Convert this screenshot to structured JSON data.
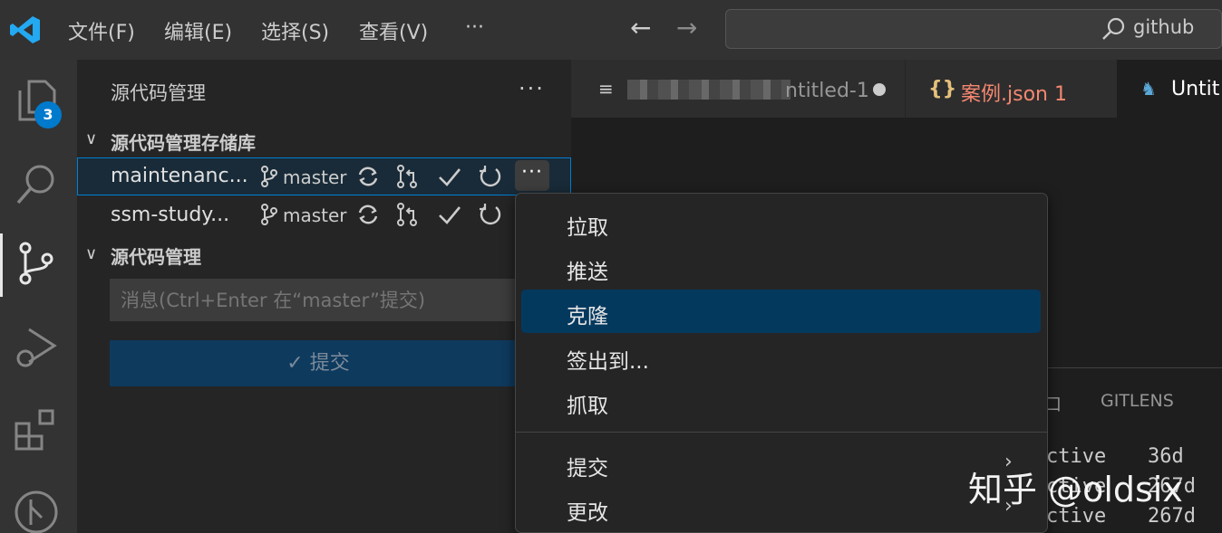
{
  "titlebar": {
    "menus": [
      "文件(F)",
      "编辑(E)",
      "选择(S)",
      "查看(V)",
      "···"
    ],
    "search_text": "github",
    "back_arrow": "←",
    "forward_arrow": "→"
  },
  "activitybar": {
    "explorer_badge": "3"
  },
  "sidebar": {
    "title": "源代码管理",
    "more": "···",
    "repos_section": "源代码管理存储库",
    "repos": [
      {
        "name": "maintenanc...",
        "branch": "master"
      },
      {
        "name": "ssm-study...",
        "branch": "master"
      }
    ],
    "scm_section": "源代码管理",
    "message_placeholder": "消息(Ctrl+Enter 在“master”提交)",
    "commit_label": "✓ 提交"
  },
  "tabs": [
    {
      "label": "ntitled-1"
    },
    {
      "label": "案例.json 1",
      "icon": "{}"
    },
    {
      "label": "Untit"
    }
  ],
  "panel": {
    "tab_partial": "口",
    "gitlens": "GITLENS",
    "rows": [
      {
        "text": "ctive",
        "age": "36d"
      },
      {
        "text": "ctive",
        "age": "267d"
      },
      {
        "text": "ctive",
        "age": "267d"
      }
    ]
  },
  "context_menu": {
    "items": [
      {
        "label": "拉取"
      },
      {
        "label": "推送"
      },
      {
        "label": "克隆",
        "highlighted": true
      },
      {
        "label": "签出到..."
      },
      {
        "label": "抓取"
      },
      {
        "label": "提交",
        "submenu": true
      },
      {
        "label": "更改",
        "submenu": true
      }
    ]
  },
  "watermark": "知乎 @oldsix",
  "colors": {
    "accent": "#007acc",
    "highlight": "#04395e",
    "json_tab": "#f48771"
  }
}
